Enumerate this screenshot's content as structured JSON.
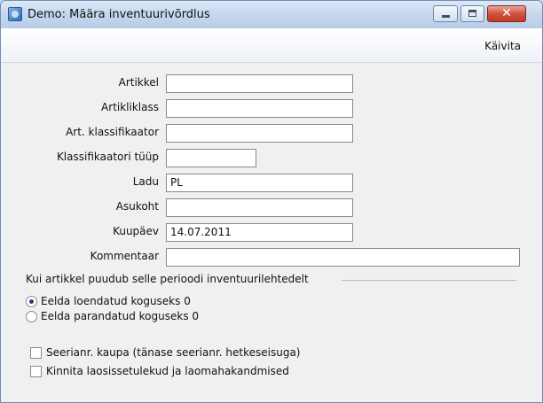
{
  "window": {
    "title": "Demo: Määra inventuurivõrdlus",
    "close_glyph": "✕"
  },
  "toolbar": {
    "run_label": "Käivita"
  },
  "fields": [
    {
      "label": "Artikkel",
      "value": ""
    },
    {
      "label": "Artikliklass",
      "value": ""
    },
    {
      "label": "Art. klassifikaator",
      "value": ""
    },
    {
      "label": "Klassifikaatori tüüp",
      "value": ""
    },
    {
      "label": "Ladu",
      "value": "PL"
    },
    {
      "label": "Asukoht",
      "value": ""
    },
    {
      "label": "Kuupäev",
      "value": "14.07.2011"
    },
    {
      "label": "Kommentaar",
      "value": ""
    }
  ],
  "missing_group": {
    "title": "Kui artikkel puudub selle perioodi inventuurilehtedelt",
    "options": [
      {
        "label": "Eelda loendatud koguseks 0",
        "selected": true
      },
      {
        "label": "Eelda parandatud koguseks 0",
        "selected": false
      }
    ]
  },
  "checkboxes": [
    {
      "label": "Seerianr. kaupa (tänase seerianr. hetkeseisuga)",
      "checked": false
    },
    {
      "label": "Kinnita laosissetulekud ja laomahakandmised",
      "checked": false
    }
  ],
  "icons": {
    "app": "app-icon",
    "minimize": "minimize-icon",
    "maximize": "maximize-icon",
    "close": "close-icon"
  }
}
